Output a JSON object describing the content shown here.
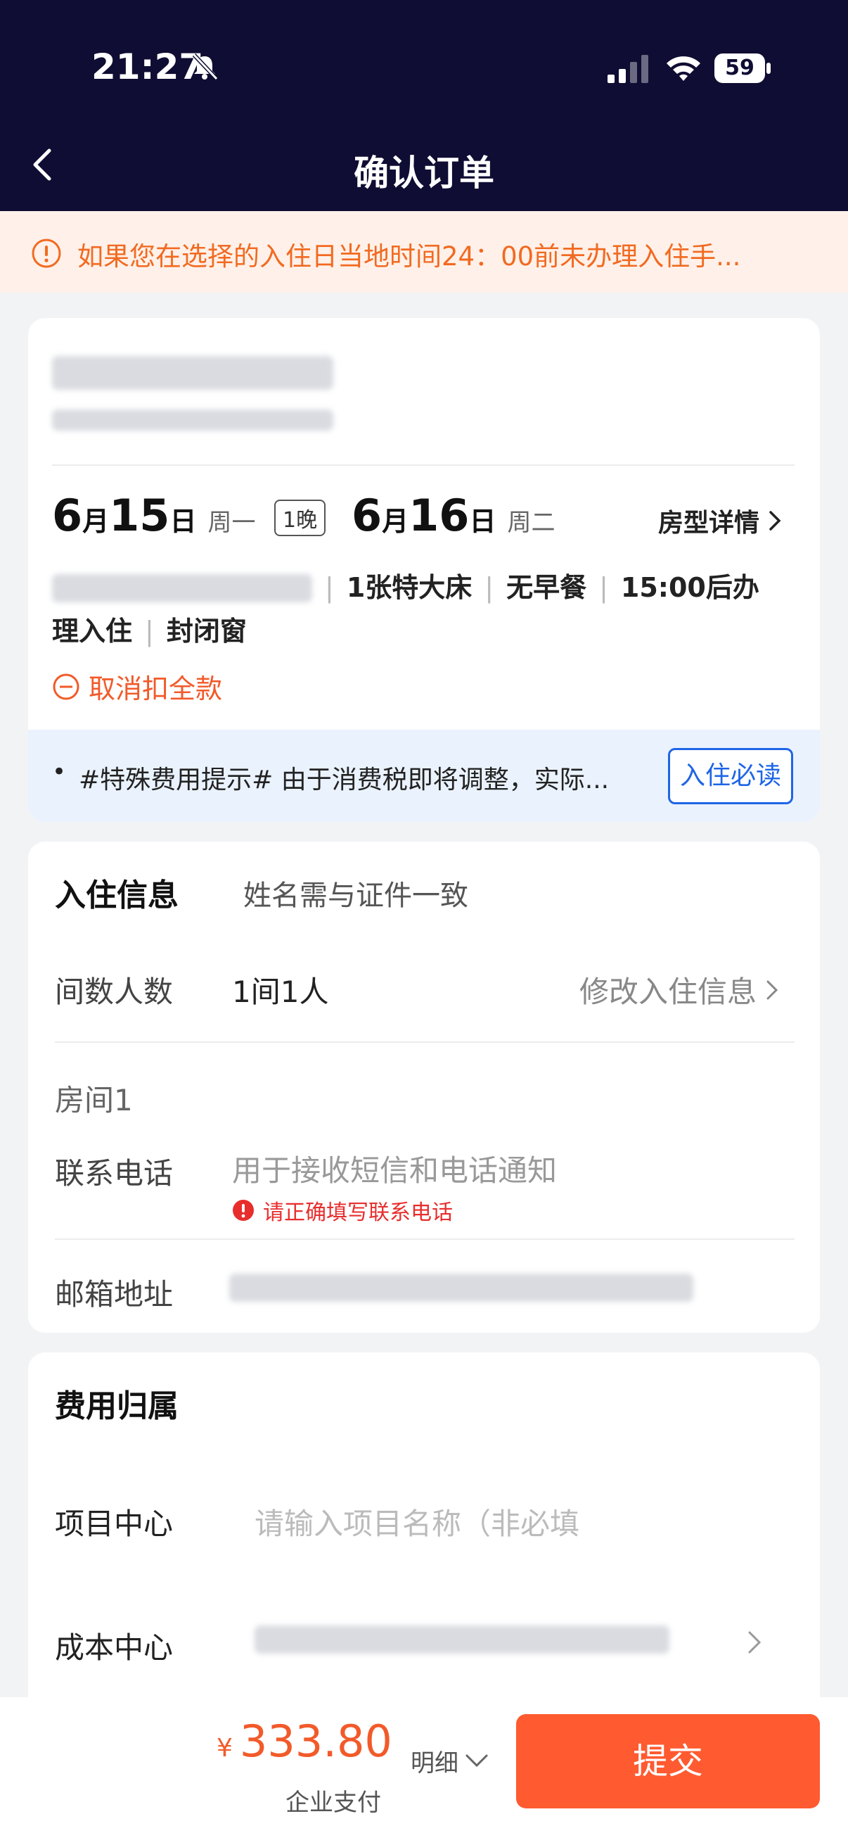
{
  "status": {
    "time": "21:27",
    "battery": "59"
  },
  "nav": {
    "title": "确认订单"
  },
  "notice": {
    "text": "如果您在选择的入住日当地时间24：00前未办理入住手..."
  },
  "booking": {
    "checkin": {
      "month": "6",
      "month_unit": "月",
      "day": "15",
      "day_unit": "日",
      "weekday": "周一"
    },
    "nights": "1晚",
    "checkout": {
      "month": "6",
      "month_unit": "月",
      "day": "16",
      "day_unit": "日",
      "weekday": "周二"
    },
    "room_detail_label": "房型详情",
    "features": [
      "1张特大床",
      "无早餐",
      "15:00后办"
    ],
    "features_line2": [
      "理入住",
      "封闭窗"
    ],
    "cancel_policy": "取消扣全款",
    "tip_text": "#特殊费用提示# 由于消费税即将调整，实际...",
    "must_read": "入住必读"
  },
  "guest": {
    "title": "入住信息",
    "hint": "姓名需与证件一致",
    "rooms_label": "间数人数",
    "rooms_value": "1间1人",
    "modify_label": "修改入住信息",
    "room_label": "房间1",
    "phone_label": "联系电话",
    "phone_placeholder": "用于接收短信和电话通知",
    "phone_error": "请正确填写联系电话",
    "email_label": "邮箱地址"
  },
  "cost": {
    "title": "费用归属",
    "project_label": "项目中心",
    "project_placeholder": "请输入项目名称（非必填",
    "cost_center_label": "成本中心"
  },
  "footer": {
    "currency": "¥",
    "price": "333.80",
    "pay_type": "企业支付",
    "detail_label": "明细",
    "submit_label": "提交"
  },
  "colors": {
    "header_bg": "#0f0d33",
    "accent": "#ff5a30",
    "link_blue": "#1f65e6"
  }
}
